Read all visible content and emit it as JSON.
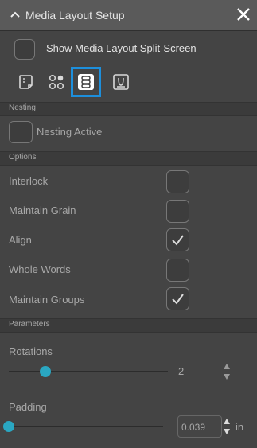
{
  "window": {
    "title": "Media Layout Setup"
  },
  "split_screen": {
    "label": "Show Media Layout Split-Screen",
    "checked": false
  },
  "tabs": [
    {
      "name": "media-tab",
      "selected": false
    },
    {
      "name": "cut-order-tab",
      "selected": false
    },
    {
      "name": "nesting-tab",
      "selected": true
    },
    {
      "name": "advanced-tab",
      "selected": false
    }
  ],
  "nesting": {
    "header": "Nesting",
    "active_label": "Nesting Active",
    "active_checked": false
  },
  "options": {
    "header": "Options",
    "items": [
      {
        "label": "Interlock",
        "checked": false
      },
      {
        "label": "Maintain Grain",
        "checked": false
      },
      {
        "label": "Align",
        "checked": true
      },
      {
        "label": "Whole Words",
        "checked": false
      },
      {
        "label": "Maintain Groups",
        "checked": true
      }
    ]
  },
  "parameters": {
    "header": "Parameters",
    "rotations": {
      "label": "Rotations",
      "value": "2",
      "slider_fraction": 0.23
    },
    "padding": {
      "label": "Padding",
      "value": "0.039",
      "unit": "in",
      "slider_fraction": 0.0
    }
  },
  "colors": {
    "accent": "#1d8fdc",
    "slider": "#2aa7c2"
  }
}
